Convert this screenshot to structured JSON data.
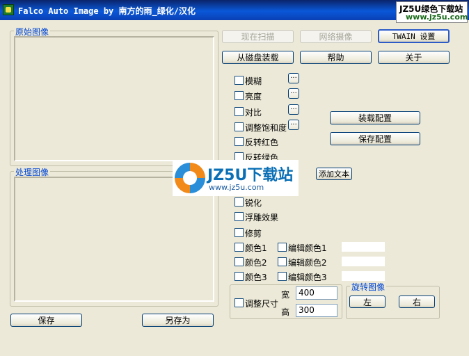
{
  "window": {
    "title": "Falco Auto Image by  南方的雨_绿化/汉化"
  },
  "brand": {
    "line1": "JZ5U绿色下载站",
    "line2": "www.jz5u.com"
  },
  "groups": {
    "original": "原始图像",
    "processed": "处理图像",
    "resize": "",
    "rotate": "旋转图像"
  },
  "buttons": {
    "scan_now": "现在扫描",
    "webcam": "网络摄像",
    "twain": "TWAIN 设置",
    "load_disk": "从磁盘装载",
    "help": "帮助",
    "about": "关于",
    "load_config": "装载配置",
    "save_config": "保存配置",
    "add_text": "添加文本",
    "save": "保存",
    "save_as": "另存为",
    "rotate_left": "左",
    "rotate_right": "右",
    "dots": "..."
  },
  "options": {
    "blur": "模糊",
    "brightness": "亮度",
    "contrast": "对比",
    "saturation": "调整饱和度",
    "invert_red": "反转红色",
    "invert_green": "反转绿色",
    "sharpen": "锐化",
    "emboss": "浮雕效果",
    "crop": "修剪",
    "color1": "颜色1",
    "color2": "颜色2",
    "color3": "颜色3",
    "edit_color1": "编辑颜色1",
    "edit_color2": "编辑颜色2",
    "edit_color3": "编辑颜色3",
    "resize": "调整尺寸"
  },
  "resize": {
    "width_label": "宽",
    "height_label": "高",
    "width_value": "400",
    "height_value": "300"
  },
  "watermark": {
    "main": "JZ5U下载站",
    "sub": "www.jz5u.com"
  }
}
